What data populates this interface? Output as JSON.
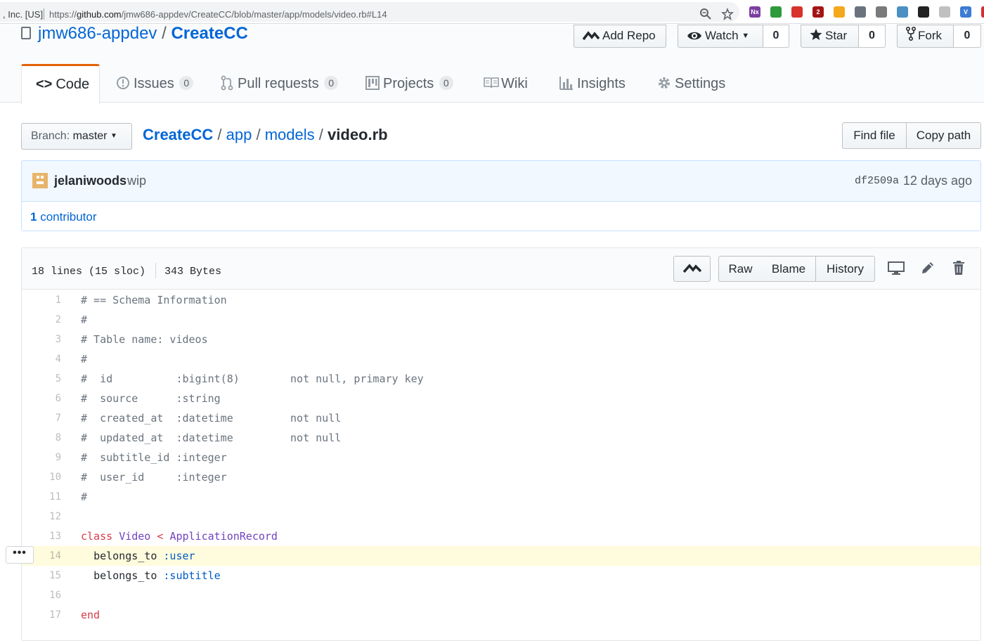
{
  "browser": {
    "secure_label": ", Inc. [US]",
    "url_prefix": "https://",
    "url_host": "github.com",
    "url_path": "/jmw686-appdev/CreateCC/blob/master/app/models/video.rb#L14",
    "extensions": [
      {
        "name": "onenote-ext",
        "label": "Nx",
        "color": "#7b3fa0"
      },
      {
        "name": "green-ext",
        "label": "",
        "color": "#2e9b3b"
      },
      {
        "name": "red-ext",
        "label": "",
        "color": "#d6342c"
      },
      {
        "name": "ublock-ext",
        "label": "2",
        "color": "#a31515"
      },
      {
        "name": "colorful-ext",
        "label": "",
        "color": "#f4a81d"
      },
      {
        "name": "github-ext",
        "label": "",
        "color": "#6a737d"
      },
      {
        "name": "cloud-ext",
        "label": "",
        "color": "#7a7a7a"
      },
      {
        "name": "search-ext",
        "label": "",
        "color": "#4a90c2"
      },
      {
        "name": "zenhub-ext",
        "label": "",
        "color": "#222222"
      },
      {
        "name": "gray-ext",
        "label": "",
        "color": "#c0c0c0"
      },
      {
        "name": "v-ext",
        "label": "V",
        "color": "#3b7bd4"
      },
      {
        "name": "red-corner-ext",
        "label": "",
        "color": "#d32f2f"
      }
    ]
  },
  "repo": {
    "owner": "jmw686-appdev",
    "separator": "/",
    "name": "CreateCC",
    "add_repo_label": "Add Repo",
    "watch_label": "Watch",
    "watch_count": "0",
    "star_label": "Star",
    "star_count": "0",
    "fork_label": "Fork",
    "fork_count": "0"
  },
  "tabs": [
    {
      "label": "Code",
      "count": null
    },
    {
      "label": "Issues",
      "count": "0"
    },
    {
      "label": "Pull requests",
      "count": "0"
    },
    {
      "label": "Projects",
      "count": "0"
    },
    {
      "label": "Wiki",
      "count": null
    },
    {
      "label": "Insights",
      "count": null
    },
    {
      "label": "Settings",
      "count": null
    }
  ],
  "breadcrumb": {
    "branch_prefix": "Branch:",
    "branch": "master",
    "root": "CreateCC",
    "parts": [
      "app",
      "models"
    ],
    "file": "video.rb",
    "sep": "/",
    "find_file": "Find file",
    "copy_path": "Copy path"
  },
  "commit": {
    "author": "jelaniwoods",
    "message": "wip",
    "sha": "df2509a",
    "age": "12 days ago",
    "contributors_count": "1",
    "contributors_label": "contributor"
  },
  "file": {
    "lines_info": "18 lines (15 sloc)",
    "size": "343 Bytes",
    "raw": "Raw",
    "blame": "Blame",
    "history": "History",
    "highlighted_line": 14,
    "lines": [
      {
        "n": "1",
        "text": "# == Schema Information"
      },
      {
        "n": "2",
        "text": "#"
      },
      {
        "n": "3",
        "text": "# Table name: videos"
      },
      {
        "n": "4",
        "text": "#"
      },
      {
        "n": "5",
        "text": "#  id          :bigint(8)        not null, primary key"
      },
      {
        "n": "6",
        "text": "#  source      :string"
      },
      {
        "n": "7",
        "text": "#  created_at  :datetime         not null"
      },
      {
        "n": "8",
        "text": "#  updated_at  :datetime         not null"
      },
      {
        "n": "9",
        "text": "#  subtitle_id :integer"
      },
      {
        "n": "10",
        "text": "#  user_id     :integer"
      },
      {
        "n": "11",
        "text": "#"
      },
      {
        "n": "12",
        "text": ""
      },
      {
        "n": "13",
        "kw": "class",
        "cls": "Video",
        "op": " < ",
        "parent": "ApplicationRecord"
      },
      {
        "n": "14",
        "indent": "  ",
        "call": "belongs_to",
        "sym": ":user"
      },
      {
        "n": "15",
        "indent": "  ",
        "call": "belongs_to",
        "sym": ":subtitle"
      },
      {
        "n": "16",
        "text": ""
      },
      {
        "n": "17",
        "kw_only": "end"
      }
    ],
    "line_menu": "•••"
  }
}
